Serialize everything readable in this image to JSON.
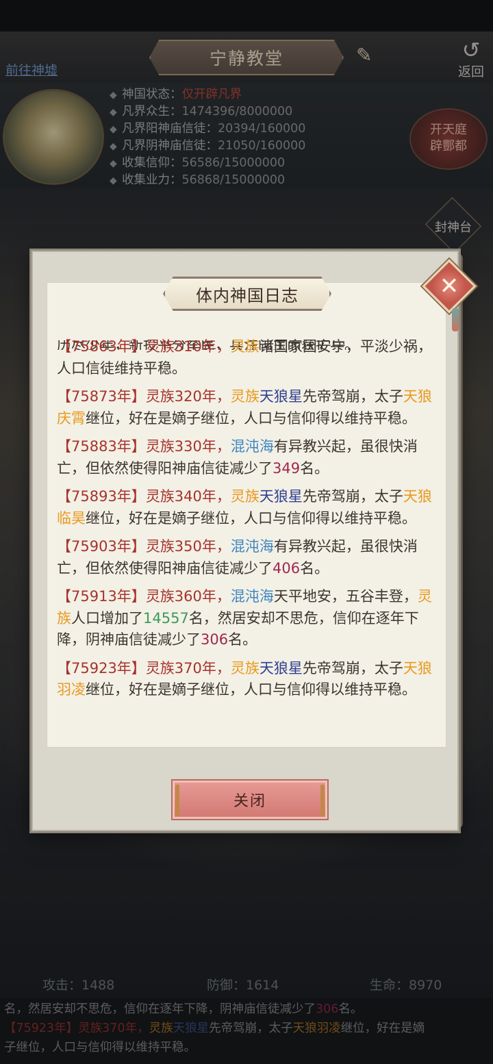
{
  "header": {
    "title": "宁静教堂",
    "nav_link": "前往神墟",
    "back_label": "返回"
  },
  "status": {
    "items": [
      {
        "key": "神国状态：",
        "value": "仅开辟凡界",
        "highlight": true
      },
      {
        "key": "凡界众生：",
        "value": "1474396/8000000"
      },
      {
        "key": "凡界阳神庙信徒：",
        "value": "20394/160000"
      },
      {
        "key": "凡界阴神庙信徒：",
        "value": "21050/160000"
      },
      {
        "key": "收集信仰：",
        "value": "56586/15000000"
      },
      {
        "key": "收集业力：",
        "value": "56868/15000000"
      }
    ],
    "open_court_button": "开天庭\n辟酆都",
    "side_button": "封神台"
  },
  "stats": {
    "attack": "攻击：1488",
    "defense": "防御：1614",
    "life": "生命：8970"
  },
  "ticker": {
    "line1_a": "名，然居安却不思危，信仰在逐年下降，阴神庙信徒减少了",
    "line1_num": "306",
    "line1_b": "名。",
    "line2_year": "【75923年】",
    "line2_a": "灵族370年，",
    "line2_race": "灵族",
    "line2_star": "天狼星",
    "line2_b": "先帝驾崩，太子",
    "line2_heir": "天狼羽凌",
    "line2_c": "继位，好在是嫡",
    "line3": "子继位，人口与信仰得以维持平稳。"
  },
  "dialog": {
    "title": "体内神国日志",
    "cut_line": "历尽少年，新投平分举民，兵注国主而获扩兵。",
    "entries": [
      {
        "year": "【75863年】",
        "segments": [
          {
            "t": "灵族310年，",
            "c": "y"
          },
          {
            "t": "灵族",
            "c": "o"
          },
          {
            "t": "诸国家国安宁，平淡少祸，人口信徒维持平稳。",
            "c": ""
          }
        ]
      },
      {
        "year": "【75873年】",
        "segments": [
          {
            "t": "灵族320年，",
            "c": "y"
          },
          {
            "t": "灵族",
            "c": "o"
          },
          {
            "t": "天狼星",
            "c": "n"
          },
          {
            "t": "先帝驾崩，太子",
            "c": ""
          },
          {
            "t": "天狼庆霄",
            "c": "o"
          },
          {
            "t": "继位，好在是嫡子继位，人口与信仰得以维持平稳。",
            "c": ""
          }
        ]
      },
      {
        "year": "【75883年】",
        "segments": [
          {
            "t": "灵族330年，",
            "c": "y"
          },
          {
            "t": "混沌海",
            "c": "b"
          },
          {
            "t": "有异教兴起，虽很快消亡，但依然使得阳神庙信徒减少了",
            "c": ""
          },
          {
            "t": "349",
            "c": "m"
          },
          {
            "t": "名。",
            "c": ""
          }
        ]
      },
      {
        "year": "【75893年】",
        "segments": [
          {
            "t": "灵族340年，",
            "c": "y"
          },
          {
            "t": "灵族",
            "c": "o"
          },
          {
            "t": "天狼星",
            "c": "n"
          },
          {
            "t": "先帝驾崩，太子",
            "c": ""
          },
          {
            "t": "天狼临昊",
            "c": "o"
          },
          {
            "t": "继位，好在是嫡子继位，人口与信仰得以维持平稳。",
            "c": ""
          }
        ]
      },
      {
        "year": "【75903年】",
        "segments": [
          {
            "t": "灵族350年，",
            "c": "y"
          },
          {
            "t": "混沌海",
            "c": "b"
          },
          {
            "t": "有异教兴起，虽很快消亡，但依然使得阳神庙信徒减少了",
            "c": ""
          },
          {
            "t": "406",
            "c": "m"
          },
          {
            "t": "名。",
            "c": ""
          }
        ]
      },
      {
        "year": "【75913年】",
        "segments": [
          {
            "t": "灵族360年，",
            "c": "y"
          },
          {
            "t": "混沌海",
            "c": "b"
          },
          {
            "t": "天平地安，五谷丰登，",
            "c": ""
          },
          {
            "t": "灵族",
            "c": "o"
          },
          {
            "t": "人口增加了",
            "c": ""
          },
          {
            "t": "14557",
            "c": "g"
          },
          {
            "t": "名，然居安却不思危，信仰在逐年下降，阴神庙信徒减少了",
            "c": ""
          },
          {
            "t": "306",
            "c": "m"
          },
          {
            "t": "名。",
            "c": ""
          }
        ]
      },
      {
        "year": "【75923年】",
        "segments": [
          {
            "t": "灵族370年，",
            "c": "y"
          },
          {
            "t": "灵族",
            "c": "o"
          },
          {
            "t": "天狼星",
            "c": "n"
          },
          {
            "t": "先帝驾崩，太子",
            "c": ""
          },
          {
            "t": "天狼羽凌",
            "c": "o"
          },
          {
            "t": "继位，好在是嫡子继位，人口与信仰得以维持平稳。",
            "c": ""
          }
        ]
      }
    ],
    "close_button": "关闭"
  },
  "colors": {
    "year_red": "#a6332b",
    "race_orange": "#e89a1d",
    "star_navy": "#2f3f8f",
    "sea_blue": "#3d86c0",
    "loss_magenta": "#a0284f",
    "gain_green": "#3c9a5a",
    "close_button_pink": "#d27872"
  }
}
